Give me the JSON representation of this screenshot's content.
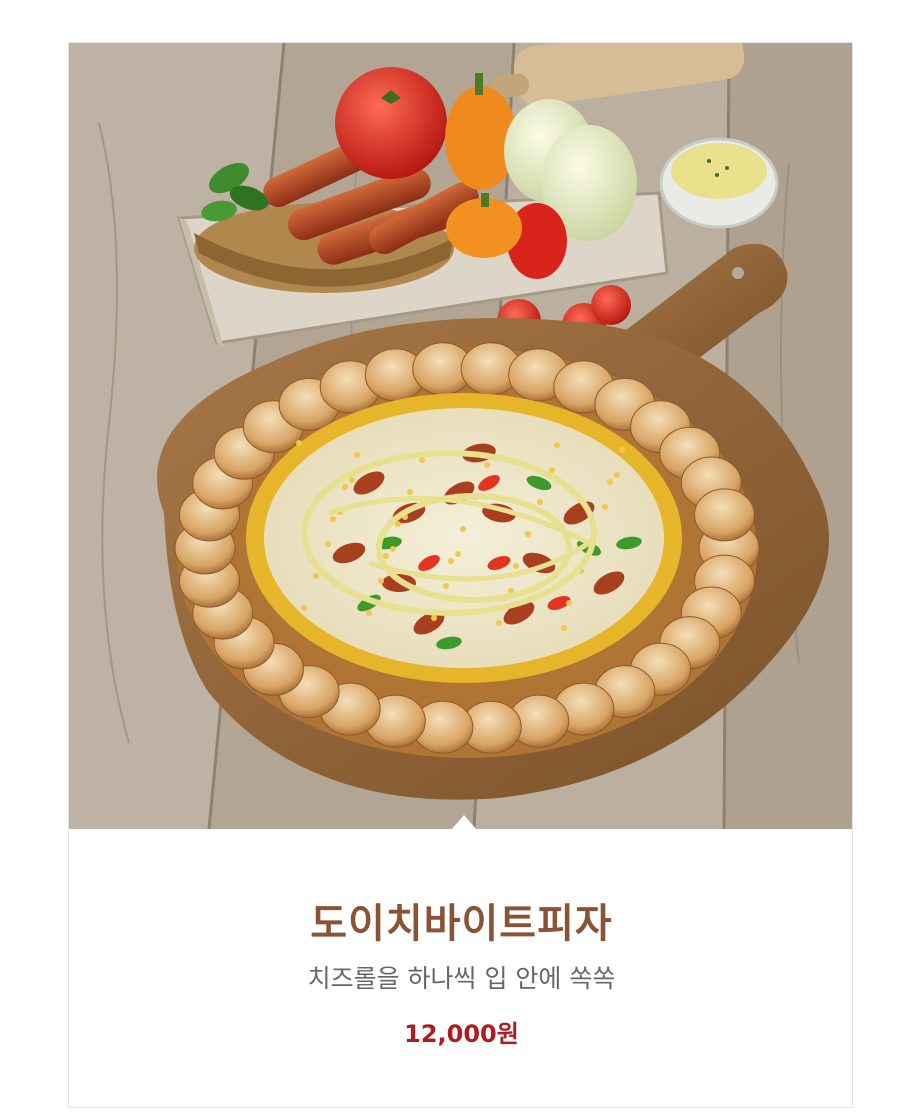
{
  "product": {
    "image_alt": "도이치바이트피자",
    "name": "도이치바이트피자",
    "description": "치즈롤을 하나씩 입 안에 쏙쏙",
    "price": "12,000원"
  },
  "colors": {
    "title": "#8a5434",
    "description": "#666666",
    "price": "#b01a22"
  }
}
